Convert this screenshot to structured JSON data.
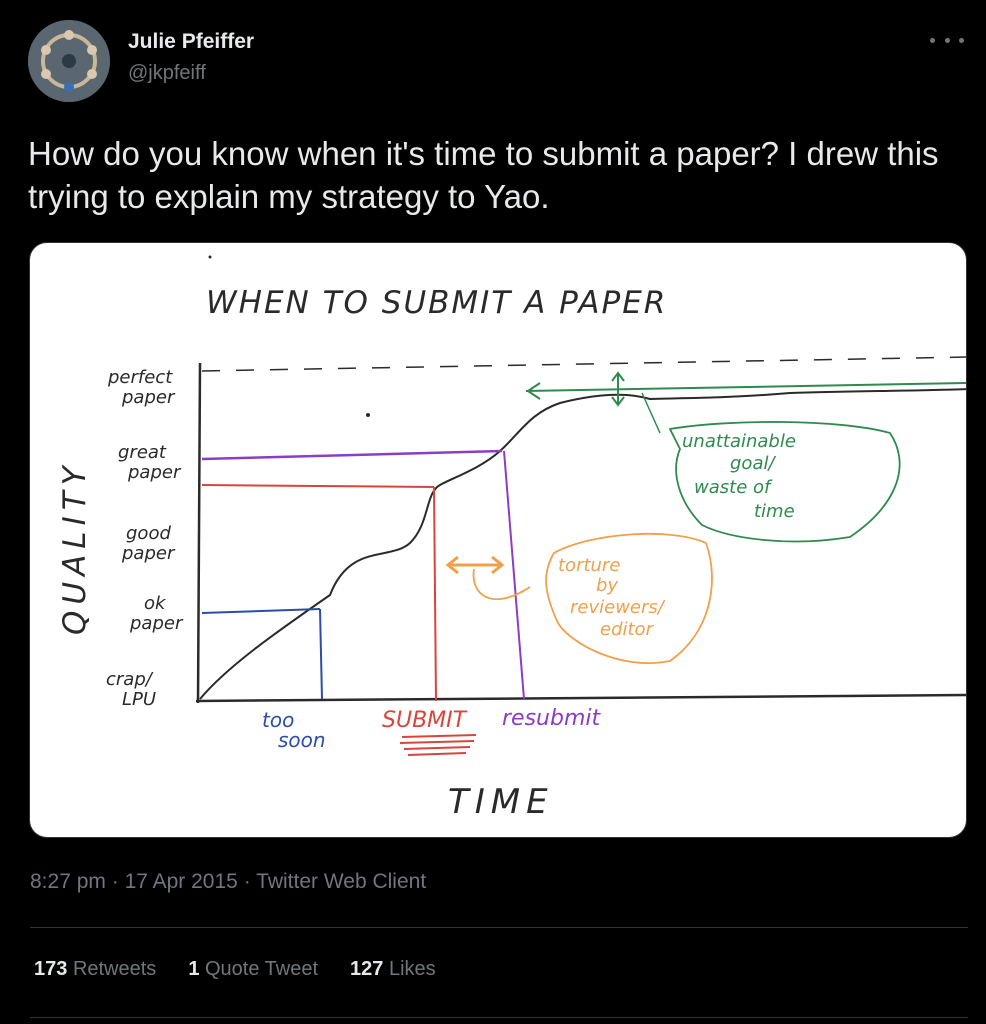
{
  "author": {
    "name": "Julie Pfeiffer",
    "handle": "@jkpfeiff"
  },
  "tweet": {
    "text": "How do you know when it's time to submit a paper? I drew this trying to explain my strategy to Yao."
  },
  "drawing": {
    "title": "WHEN TO SUBMIT A PAPER",
    "y_axis_label": "QUALITY",
    "x_axis_label": "TIME",
    "y_levels": [
      "perfect paper",
      "great paper",
      "good paper",
      "ok paper",
      "crap/ LPU"
    ],
    "marks": {
      "too_soon": "too soon",
      "submit": "SUBMIT",
      "resubmit": "resubmit"
    },
    "annotations": {
      "goal": "unattainable goal/ waste of time",
      "torture": "torture by reviewers/ editor"
    },
    "colors": {
      "ink": "#2a2a2a",
      "blue": "#2a4ea8",
      "red": "#d9453c",
      "purple": "#8d3cc4",
      "green": "#2f8a4e",
      "orange": "#f0a04a"
    }
  },
  "meta": {
    "time": "8:27 pm",
    "date": "17 Apr 2015",
    "client": "Twitter Web Client",
    "separator": "·"
  },
  "stats": {
    "retweets_count": "173",
    "retweets_label": "Retweets",
    "quotes_count": "1",
    "quotes_label": "Quote Tweet",
    "likes_count": "127",
    "likes_label": "Likes"
  }
}
